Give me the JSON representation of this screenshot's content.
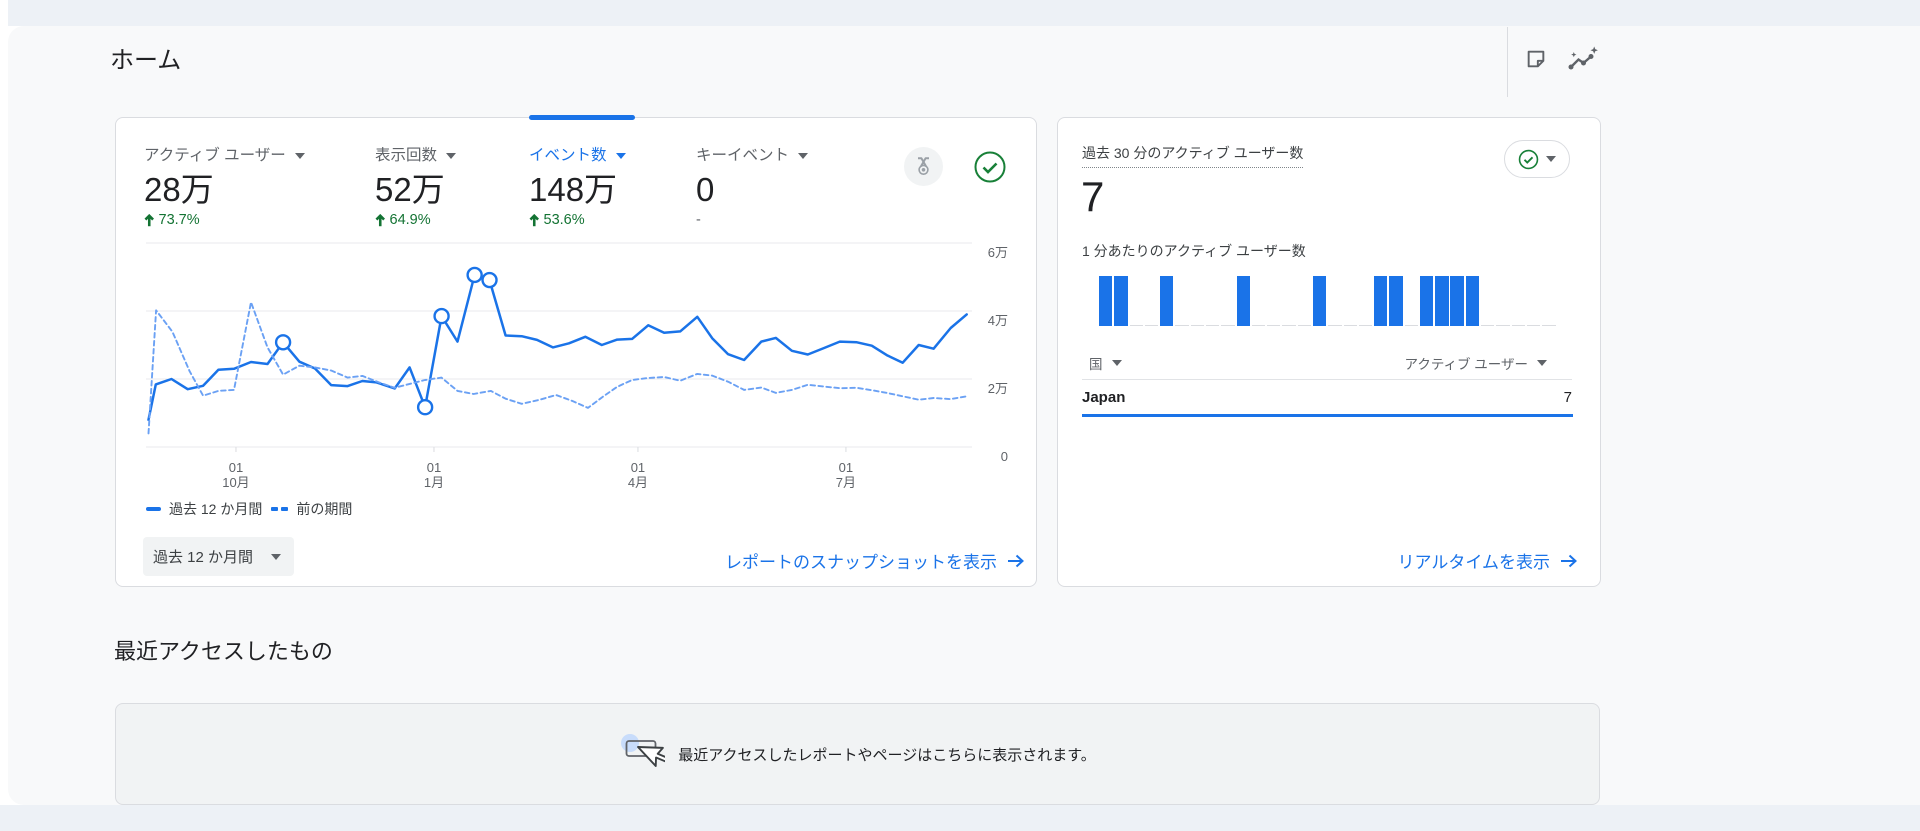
{
  "header": {
    "title": "ホーム"
  },
  "colors": {
    "accent": "#1a73e8",
    "dashed_line": "#6ba1f4",
    "positive": "#137333",
    "check_green": "#188038",
    "band": "#edf1f6",
    "panel": "#f8f9fa",
    "card_border": "#dadce0",
    "empty_box": "#f1f3f4"
  },
  "metrics": {
    "tabs": [
      {
        "label": "アクティブ ユーザー",
        "value": "28万",
        "delta": "73.7%",
        "delta_dir": "up",
        "selected": false
      },
      {
        "label": "表示回数",
        "value": "52万",
        "delta": "64.9%",
        "delta_dir": "up",
        "selected": false
      },
      {
        "label": "イベント数",
        "value": "148万",
        "delta": "53.6%",
        "delta_dir": "up",
        "selected": true
      },
      {
        "label": "キーイベント",
        "value": "0",
        "delta": "-",
        "delta_dir": "none",
        "selected": false
      }
    ]
  },
  "trend": {
    "legend": [
      {
        "label": "過去 12 か月間",
        "style": "solid"
      },
      {
        "label": "前の期間",
        "style": "dashed"
      }
    ],
    "range_button": "過去 12 か月間",
    "link": "レポートのスナップショットを表示"
  },
  "realtime": {
    "title": "過去 30 分のアクティブ ユーザー数",
    "value": "7",
    "per_minute_label": "1 分あたりのアクティブ ユーザー数",
    "table": {
      "dimension": "国",
      "metric": "アクティブ ユーザー",
      "rows": [
        {
          "name": "Japan",
          "value": "7"
        }
      ]
    },
    "link": "リアルタイムを表示"
  },
  "recent": {
    "title": "最近アクセスしたもの",
    "empty_text": "最近アクセスしたレポートやページはこちらに表示されます。"
  },
  "chart_data": [
    {
      "type": "line",
      "description": "イベント数 (週別, 過去 12 か月間 vs 前の期間)",
      "unit": "万",
      "ylim": [
        0,
        6
      ],
      "y_ticks": [
        {
          "v": 0,
          "label": "0"
        },
        {
          "v": 2,
          "label": "2万"
        },
        {
          "v": 4,
          "label": "4万"
        },
        {
          "v": 6,
          "label": "6万"
        }
      ],
      "x_ticks": [
        {
          "f": 0.1069,
          "line1": "01",
          "line2": "10月"
        },
        {
          "f": 0.3489,
          "line1": "01",
          "line2": "1月"
        },
        {
          "f": 0.5982,
          "line1": "01",
          "line2": "4月"
        },
        {
          "f": 0.8524,
          "line1": "01",
          "line2": "7月"
        }
      ],
      "series": [
        {
          "name": "過去 12 か月間",
          "style": "solid",
          "points": [
            [
              0.0,
              0.8
            ],
            [
              0.0089,
              1.84
            ],
            [
              0.0281,
              2.0
            ],
            [
              0.0479,
              1.7
            ],
            [
              0.0667,
              1.8
            ],
            [
              0.0854,
              2.27
            ],
            [
              0.1045,
              2.3
            ],
            [
              0.1253,
              2.5
            ],
            [
              0.1454,
              2.44
            ],
            [
              0.1645,
              3.08
            ],
            [
              0.1844,
              2.51
            ],
            [
              0.2035,
              2.31
            ],
            [
              0.2233,
              1.82
            ],
            [
              0.2433,
              1.79
            ],
            [
              0.2614,
              1.94
            ],
            [
              0.2786,
              1.9
            ],
            [
              0.3009,
              1.72
            ],
            [
              0.3191,
              2.34
            ],
            [
              0.3381,
              1.17
            ],
            [
              0.3582,
              3.85
            ],
            [
              0.3777,
              3.1
            ],
            [
              0.3986,
              5.06
            ],
            [
              0.4168,
              4.91
            ],
            [
              0.4364,
              3.28
            ],
            [
              0.4561,
              3.26
            ],
            [
              0.4748,
              3.15
            ],
            [
              0.4943,
              2.93
            ],
            [
              0.5139,
              3.05
            ],
            [
              0.5338,
              3.24
            ],
            [
              0.554,
              3.0
            ],
            [
              0.5729,
              3.16
            ],
            [
              0.5911,
              3.18
            ],
            [
              0.6107,
              3.58
            ],
            [
              0.6302,
              3.36
            ],
            [
              0.6498,
              3.4
            ],
            [
              0.6708,
              3.83
            ],
            [
              0.6889,
              3.2
            ],
            [
              0.7084,
              2.73
            ],
            [
              0.728,
              2.56
            ],
            [
              0.749,
              3.1
            ],
            [
              0.7667,
              3.21
            ],
            [
              0.7863,
              2.83
            ],
            [
              0.8058,
              2.72
            ],
            [
              0.8254,
              2.91
            ],
            [
              0.8449,
              3.1
            ],
            [
              0.8658,
              3.08
            ],
            [
              0.884,
              2.98
            ],
            [
              0.9025,
              2.7
            ],
            [
              0.9218,
              2.48
            ],
            [
              0.9413,
              3.0
            ],
            [
              0.9596,
              2.89
            ],
            [
              0.9804,
              3.5
            ],
            [
              1.0,
              3.9
            ]
          ]
        },
        {
          "name": "前の期間",
          "style": "dashed",
          "points": [
            [
              0.0,
              0.4
            ],
            [
              0.0093,
              4.02
            ],
            [
              0.0292,
              3.39
            ],
            [
              0.0502,
              2.23
            ],
            [
              0.0667,
              1.51
            ],
            [
              0.0854,
              1.65
            ],
            [
              0.1045,
              1.68
            ],
            [
              0.1253,
              4.26
            ],
            [
              0.1454,
              2.93
            ],
            [
              0.1645,
              2.13
            ],
            [
              0.1844,
              2.39
            ],
            [
              0.2035,
              2.34
            ],
            [
              0.2233,
              2.25
            ],
            [
              0.2433,
              2.04
            ],
            [
              0.2614,
              2.09
            ],
            [
              0.2816,
              1.9
            ],
            [
              0.3009,
              1.74
            ],
            [
              0.3198,
              1.86
            ],
            [
              0.3379,
              1.97
            ],
            [
              0.3581,
              2.04
            ],
            [
              0.3777,
              1.65
            ],
            [
              0.3973,
              1.56
            ],
            [
              0.4183,
              1.65
            ],
            [
              0.4364,
              1.42
            ],
            [
              0.4561,
              1.27
            ],
            [
              0.4784,
              1.39
            ],
            [
              0.498,
              1.53
            ],
            [
              0.5175,
              1.36
            ],
            [
              0.5371,
              1.15
            ],
            [
              0.5554,
              1.48
            ],
            [
              0.5729,
              1.77
            ],
            [
              0.5911,
              1.97
            ],
            [
              0.6107,
              2.03
            ],
            [
              0.6302,
              2.06
            ],
            [
              0.6498,
              1.95
            ],
            [
              0.6708,
              2.15
            ],
            [
              0.6889,
              2.1
            ],
            [
              0.7084,
              1.92
            ],
            [
              0.728,
              1.68
            ],
            [
              0.749,
              1.75
            ],
            [
              0.7667,
              1.59
            ],
            [
              0.7863,
              1.68
            ],
            [
              0.8058,
              1.83
            ],
            [
              0.8254,
              1.78
            ],
            [
              0.8449,
              1.73
            ],
            [
              0.8658,
              1.74
            ],
            [
              0.884,
              1.67
            ],
            [
              0.9025,
              1.59
            ],
            [
              0.9218,
              1.49
            ],
            [
              0.9413,
              1.39
            ],
            [
              0.9596,
              1.44
            ],
            [
              0.9804,
              1.41
            ],
            [
              1.0,
              1.49
            ]
          ]
        }
      ],
      "anomaly_marker_indices": [
        9,
        18,
        19,
        21,
        22
      ],
      "legend_position": "bottom",
      "grid": "horizontal"
    },
    {
      "type": "bar",
      "description": "1 分あたりのアクティブ ユーザー数 (過去 30 分)",
      "x": "minutes (oldest to newest)",
      "values": [
        1,
        1,
        0,
        0,
        1,
        0,
        0,
        0,
        0,
        1,
        0,
        0,
        0,
        0,
        1,
        0,
        0,
        0,
        1,
        1,
        0,
        1,
        1,
        1,
        1,
        0,
        0,
        0,
        0,
        0
      ],
      "ylim": [
        0,
        1
      ]
    }
  ]
}
